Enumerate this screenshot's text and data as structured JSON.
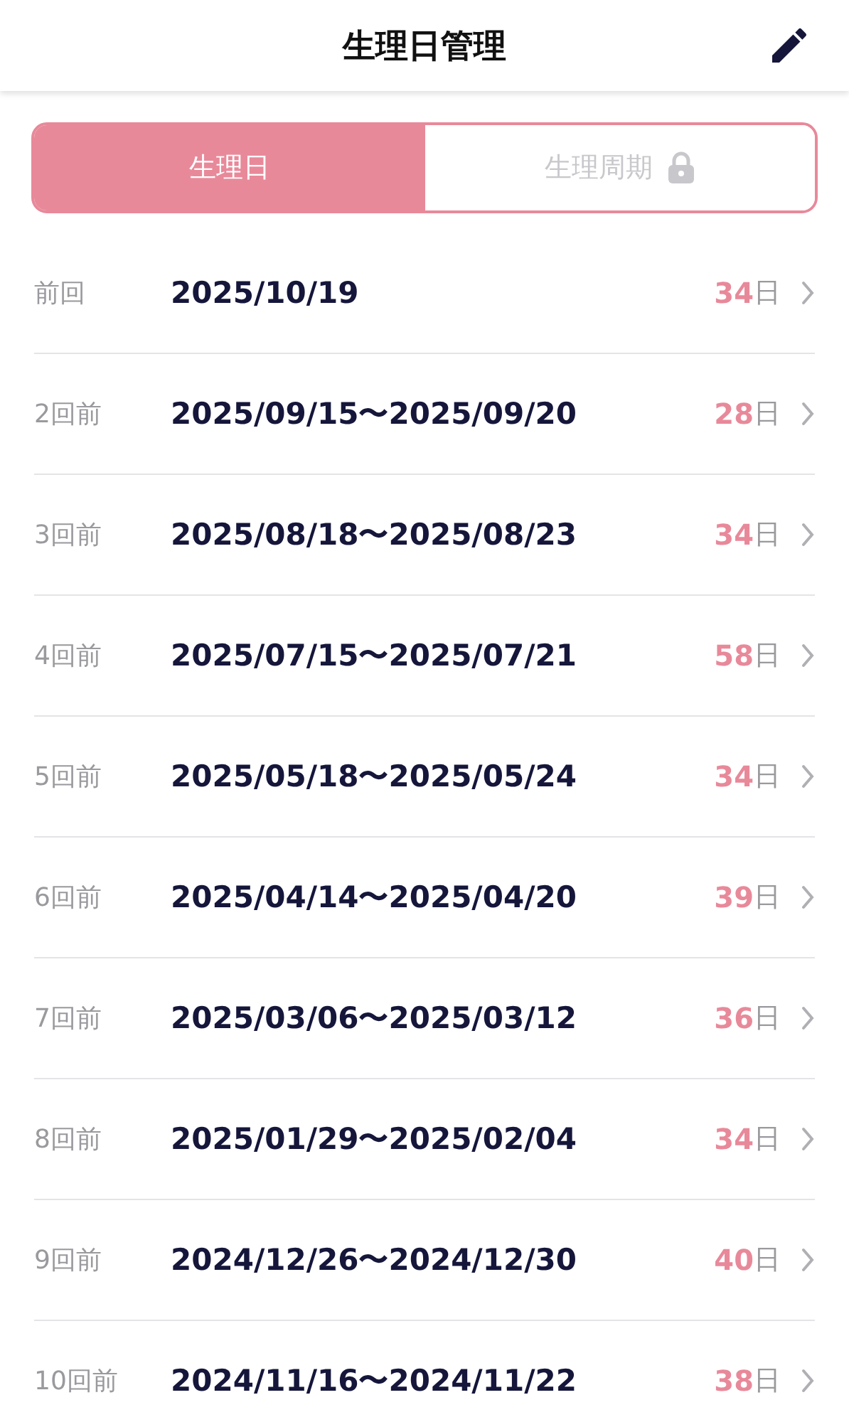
{
  "header": {
    "title": "生理日管理"
  },
  "segments": [
    {
      "label": "生理日",
      "selected": true,
      "locked": false
    },
    {
      "label": "生理周期",
      "selected": false,
      "locked": true
    }
  ],
  "records": [
    {
      "label": "前回",
      "dates": "2025/10/19",
      "days": "34",
      "unit": "日"
    },
    {
      "label": "2回前",
      "dates": "2025/09/15〜2025/09/20",
      "days": "28",
      "unit": "日"
    },
    {
      "label": "3回前",
      "dates": "2025/08/18〜2025/08/23",
      "days": "34",
      "unit": "日"
    },
    {
      "label": "4回前",
      "dates": "2025/07/15〜2025/07/21",
      "days": "58",
      "unit": "日"
    },
    {
      "label": "5回前",
      "dates": "2025/05/18〜2025/05/24",
      "days": "34",
      "unit": "日"
    },
    {
      "label": "6回前",
      "dates": "2025/04/14〜2025/04/20",
      "days": "39",
      "unit": "日"
    },
    {
      "label": "7回前",
      "dates": "2025/03/06〜2025/03/12",
      "days": "36",
      "unit": "日"
    },
    {
      "label": "8回前",
      "dates": "2025/01/29〜2025/02/04",
      "days": "34",
      "unit": "日"
    },
    {
      "label": "9回前",
      "dates": "2024/12/26〜2024/12/30",
      "days": "40",
      "unit": "日"
    },
    {
      "label": "10回前",
      "dates": "2024/11/16〜2024/11/22",
      "days": "38",
      "unit": "日"
    }
  ]
}
